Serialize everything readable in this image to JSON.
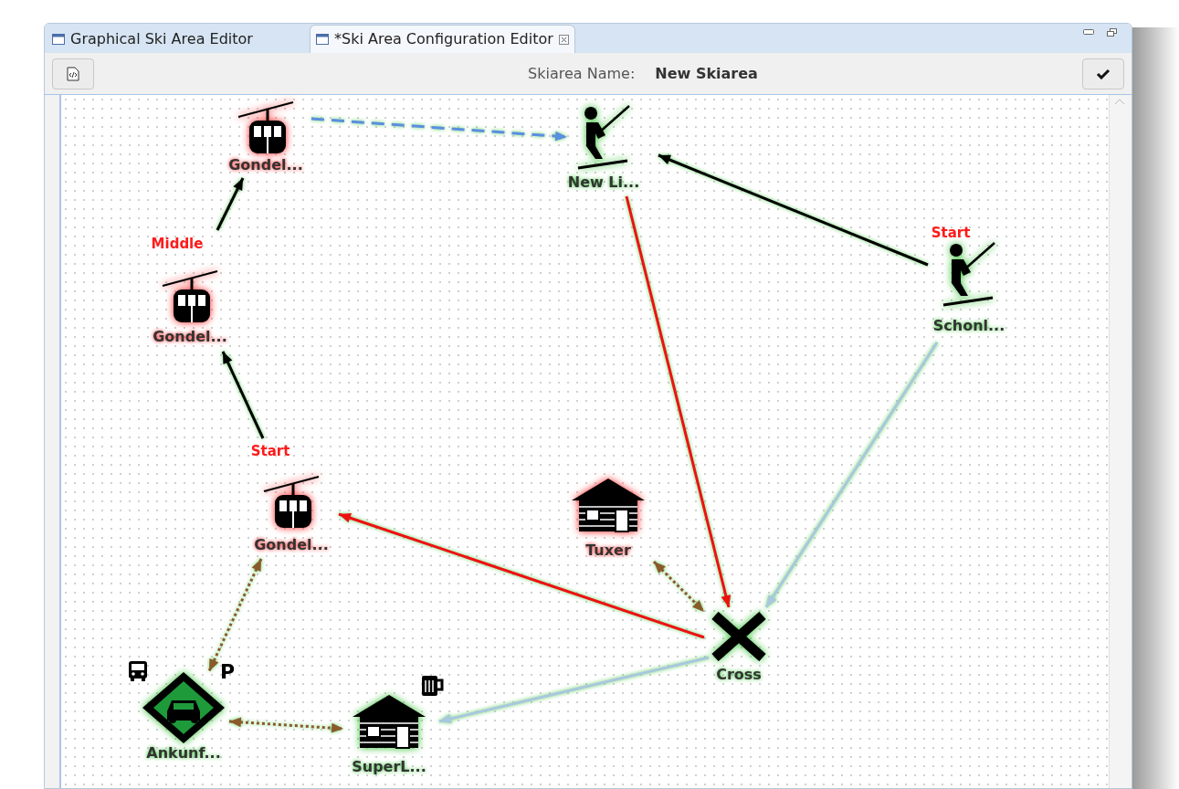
{
  "tabs": [
    {
      "label": "Graphical Ski Area Editor",
      "selected": false
    },
    {
      "label": "*Ski Area Configuration Editor",
      "selected": true
    }
  ],
  "toolbar": {
    "name_label": "Skiarea Name:",
    "name_value": "New Skiarea"
  },
  "diagram": {
    "nodes": [
      {
        "kind": "gondola",
        "label": "Gondel..."
      },
      {
        "kind": "lift",
        "label": "New Li..."
      },
      {
        "kind": "gondola",
        "label": "Gondel...",
        "role": "Middle"
      },
      {
        "kind": "lift",
        "label": "Schonl...",
        "role": "Start"
      },
      {
        "kind": "gondola",
        "label": "Gondel...",
        "role": "Start"
      },
      {
        "kind": "hut",
        "label": "Tuxer"
      },
      {
        "kind": "cross",
        "label": "Cross"
      },
      {
        "kind": "parking",
        "label": "Ankunf...",
        "extras": [
          {
            "kind": "bus"
          },
          {
            "kind": "letter",
            "text": "P"
          }
        ]
      },
      {
        "kind": "hut",
        "label": "SuperL...",
        "extras": [
          {
            "kind": "mug"
          }
        ]
      }
    ],
    "edges": [
      {
        "kind": "piste",
        "color": "#000000"
      },
      {
        "kind": "piste",
        "color": "#000000"
      },
      {
        "kind": "link",
        "color": "#5b8fe0"
      },
      {
        "kind": "piste",
        "color": "#000000"
      },
      {
        "kind": "piste",
        "color": "#ee1111"
      },
      {
        "kind": "piste",
        "color": "#a9c7dd"
      },
      {
        "kind": "piste",
        "color": "#ee1111"
      },
      {
        "kind": "walkway",
        "color": "#8a5a2b"
      },
      {
        "kind": "walkway",
        "color": "#8a5a2b"
      },
      {
        "kind": "walkway",
        "color": "#8a5a2b"
      },
      {
        "kind": "piste",
        "color": "#a9c7dd"
      }
    ]
  }
}
